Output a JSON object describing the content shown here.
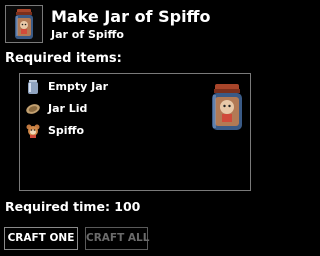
{
  "header": {
    "title": "Make Jar of Spiffo",
    "subtitle": "Jar of Spiffo",
    "icon": "jar-of-spiffo-icon"
  },
  "requirements": {
    "label": "Required items:",
    "items": [
      {
        "label": "Empty Jar",
        "icon": "empty-jar-icon"
      },
      {
        "label": "Jar Lid",
        "icon": "jar-lid-icon"
      },
      {
        "label": "Spiffo",
        "icon": "spiffo-icon"
      }
    ],
    "preview_icon": "jar-of-spiffo-preview-icon"
  },
  "time": {
    "label": "Required time: 100"
  },
  "buttons": {
    "craft_one": "CRAFT ONE",
    "craft_all": "CRAFT ALL"
  },
  "colors": {
    "background": "#000000",
    "border": "#7a7a7a",
    "text": "#ffffff",
    "disabled_text": "#6a6a6a",
    "jar_lid_red": "#9a3a22",
    "jar_glass_blue": "#3a5a86"
  }
}
